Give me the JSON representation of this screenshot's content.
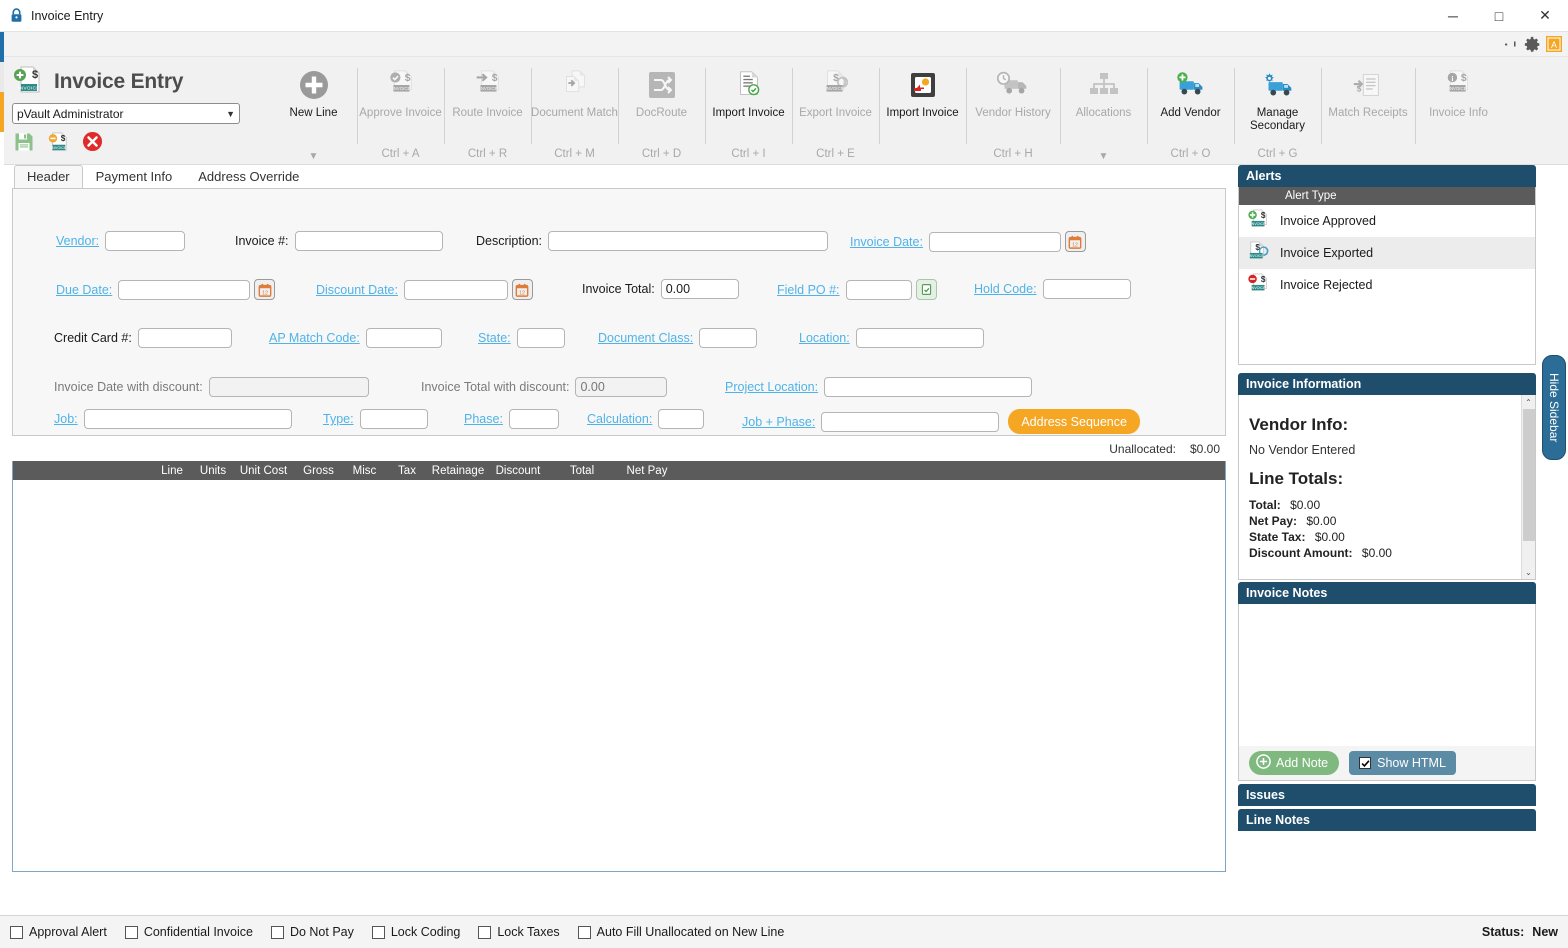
{
  "window": {
    "title": "Invoice Entry",
    "lock_icon": "lock-icon",
    "minimize": "─",
    "maximize": "□",
    "close": "✕"
  },
  "ribbon_top": {
    "pin_icon": "pin-icon",
    "gear_icon": "gear-icon",
    "badge_icon": "app-badge-icon"
  },
  "app": {
    "title": "Invoice Entry",
    "logo_icon": "invoice-add-icon",
    "user": "pVault Administrator",
    "caret": "▼",
    "quick": [
      {
        "name": "save-icon",
        "label": "Save"
      },
      {
        "name": "invoice-hold-icon",
        "label": "Hold Invoice"
      },
      {
        "name": "cancel-icon",
        "label": "Cancel"
      }
    ]
  },
  "ribbon": {
    "items": [
      {
        "label": "New Line",
        "shortcut": "",
        "arrow": "▼",
        "enabled": false,
        "icon": "plus-circle-icon"
      },
      {
        "label": "Approve Invoice",
        "shortcut": "Ctrl + A",
        "arrow": "",
        "enabled": false,
        "icon": "approve-invoice-icon"
      },
      {
        "label": "Route Invoice",
        "shortcut": "Ctrl + R",
        "arrow": "",
        "enabled": false,
        "icon": "route-invoice-icon"
      },
      {
        "label": "Document Match",
        "shortcut": "Ctrl + M",
        "arrow": "",
        "enabled": false,
        "icon": "document-match-icon"
      },
      {
        "label": "DocRoute",
        "shortcut": "Ctrl + D",
        "arrow": "",
        "enabled": false,
        "icon": "docroute-icon"
      },
      {
        "label": "Import Invoice",
        "shortcut": "Ctrl + I",
        "arrow": "",
        "enabled": true,
        "icon": "import-document-icon"
      },
      {
        "label": "Export Invoice",
        "shortcut": "Ctrl + E",
        "arrow": "",
        "enabled": false,
        "icon": "export-invoice-icon"
      },
      {
        "label": "Import Invoice",
        "shortcut": "",
        "arrow": "",
        "enabled": true,
        "icon": "import-invoice-icon"
      },
      {
        "label": "Vendor History",
        "shortcut": "Ctrl + H",
        "arrow": "",
        "enabled": false,
        "icon": "vendor-history-icon"
      },
      {
        "label": "Allocations",
        "shortcut": "",
        "arrow": "▼",
        "enabled": false,
        "icon": "allocations-icon"
      },
      {
        "label": "Add Vendor",
        "shortcut": "Ctrl + O",
        "arrow": "",
        "enabled": true,
        "icon": "add-vendor-icon"
      },
      {
        "label": "Manage Secondary",
        "shortcut": "Ctrl + G",
        "arrow": "",
        "enabled": true,
        "icon": "manage-secondary-icon"
      },
      {
        "label": "Match Receipts",
        "shortcut": "",
        "arrow": "",
        "enabled": false,
        "icon": "match-receipts-icon"
      },
      {
        "label": "Invoice Info",
        "shortcut": "",
        "arrow": "",
        "enabled": false,
        "icon": "invoice-info-icon"
      }
    ]
  },
  "tabs": [
    {
      "label": "Header",
      "active": true
    },
    {
      "label": "Payment Info",
      "active": false
    },
    {
      "label": "Address Override",
      "active": false
    }
  ],
  "form": {
    "vendor": {
      "label": "Vendor:",
      "value": "",
      "link": true
    },
    "invoice_num": {
      "label": "Invoice #:",
      "value": "",
      "link": false
    },
    "description": {
      "label": "Description:",
      "value": "",
      "link": false
    },
    "invoice_date": {
      "label": "Invoice Date:",
      "value": "",
      "link": true,
      "calendar_icon": "calendar-icon"
    },
    "due_date": {
      "label": "Due Date:",
      "value": "",
      "link": true,
      "calendar_icon": "calendar-icon"
    },
    "discount_date": {
      "label": "Discount Date:",
      "value": "",
      "link": true,
      "calendar_icon": "calendar-icon"
    },
    "invoice_total": {
      "label": "Invoice Total:",
      "value": "0.00",
      "link": false
    },
    "field_po": {
      "label": "Field PO #:",
      "value": "",
      "link": true,
      "lookup_icon": "po-lookup-icon"
    },
    "hold_code": {
      "label": "Hold Code:",
      "value": "",
      "link": true
    },
    "credit_card": {
      "label": "Credit Card #:",
      "value": "",
      "link": false
    },
    "ap_match_code": {
      "label": "AP Match Code:",
      "value": "",
      "link": true
    },
    "state": {
      "label": "State:",
      "value": "",
      "link": true
    },
    "document_class": {
      "label": "Document Class:",
      "value": "",
      "link": true
    },
    "location": {
      "label": "Location:",
      "value": "",
      "link": true
    },
    "invoice_date_discount": {
      "label": "Invoice Date with discount:",
      "value": "",
      "link": false,
      "readonly": true
    },
    "invoice_total_discount": {
      "label": "Invoice Total with discount:",
      "value": "0.00",
      "link": false,
      "readonly": true
    },
    "project_location": {
      "label": "Project Location:",
      "value": "",
      "link": true
    },
    "job": {
      "label": "Job:",
      "value": "",
      "link": true
    },
    "type": {
      "label": "Type:",
      "value": "",
      "link": true
    },
    "phase": {
      "label": "Phase:",
      "value": "",
      "link": true
    },
    "calculation": {
      "label": "Calculation:",
      "value": "",
      "link": true
    },
    "job_phase": {
      "label": "Job + Phase:",
      "value": "",
      "link": true
    },
    "address_sequence_button": "Address Sequence"
  },
  "unallocated": {
    "label": "Unallocated:",
    "value": "$0.00"
  },
  "grid": {
    "columns": [
      "Line",
      "Units",
      "Unit Cost",
      "Gross",
      "Misc",
      "Tax",
      "Retainage",
      "Discount",
      "Total",
      "Net Pay"
    ],
    "rows": []
  },
  "sidebar": {
    "alerts": {
      "title": "Alerts",
      "column_header": "Alert Type",
      "items": [
        {
          "label": "Invoice Approved",
          "icon": "invoice-approved-icon",
          "selected": false
        },
        {
          "label": "Invoice Exported",
          "icon": "invoice-exported-icon",
          "selected": true
        },
        {
          "label": "Invoice Rejected",
          "icon": "invoice-rejected-icon",
          "selected": false
        }
      ]
    },
    "invoice_information": {
      "title": "Invoice Information",
      "vendor_heading": "Vendor Info:",
      "vendor_text": "No Vendor Entered",
      "totals_heading": "Line Totals:",
      "totals": [
        {
          "label": "Total:",
          "value": "$0.00"
        },
        {
          "label": "Net Pay:",
          "value": "$0.00"
        },
        {
          "label": "State Tax:",
          "value": "$0.00"
        },
        {
          "label": "Discount Amount:",
          "value": "$0.00"
        }
      ],
      "scroll_up": "⌃",
      "scroll_down": "⌄"
    },
    "invoice_notes": {
      "title": "Invoice Notes",
      "add_note_button": "Add Note",
      "add_note_icon": "plus-circle-icon",
      "show_html_label": "Show HTML",
      "show_html_checked": true
    },
    "collapsed": [
      {
        "title": "Issues"
      },
      {
        "title": "Line Notes"
      }
    ],
    "hide_sidebar_tab": "Hide Sidebar"
  },
  "statusbar": {
    "checkboxes": [
      {
        "label": "Approval Alert",
        "checked": false
      },
      {
        "label": "Confidential Invoice",
        "checked": false
      },
      {
        "label": "Do Not Pay",
        "checked": false
      },
      {
        "label": "Lock Coding",
        "checked": false
      },
      {
        "label": "Lock Taxes",
        "checked": false
      },
      {
        "label": "Auto Fill Unallocated on New Line",
        "checked": false
      }
    ],
    "status_label": "Status:",
    "status_value": "New"
  },
  "colors": {
    "panel_header": "#1f4e6d",
    "accent_orange": "#f5a623",
    "link_blue": "#4fb3e8",
    "grid_header": "#5b5b5b",
    "add_note_green": "#7fb97f"
  }
}
